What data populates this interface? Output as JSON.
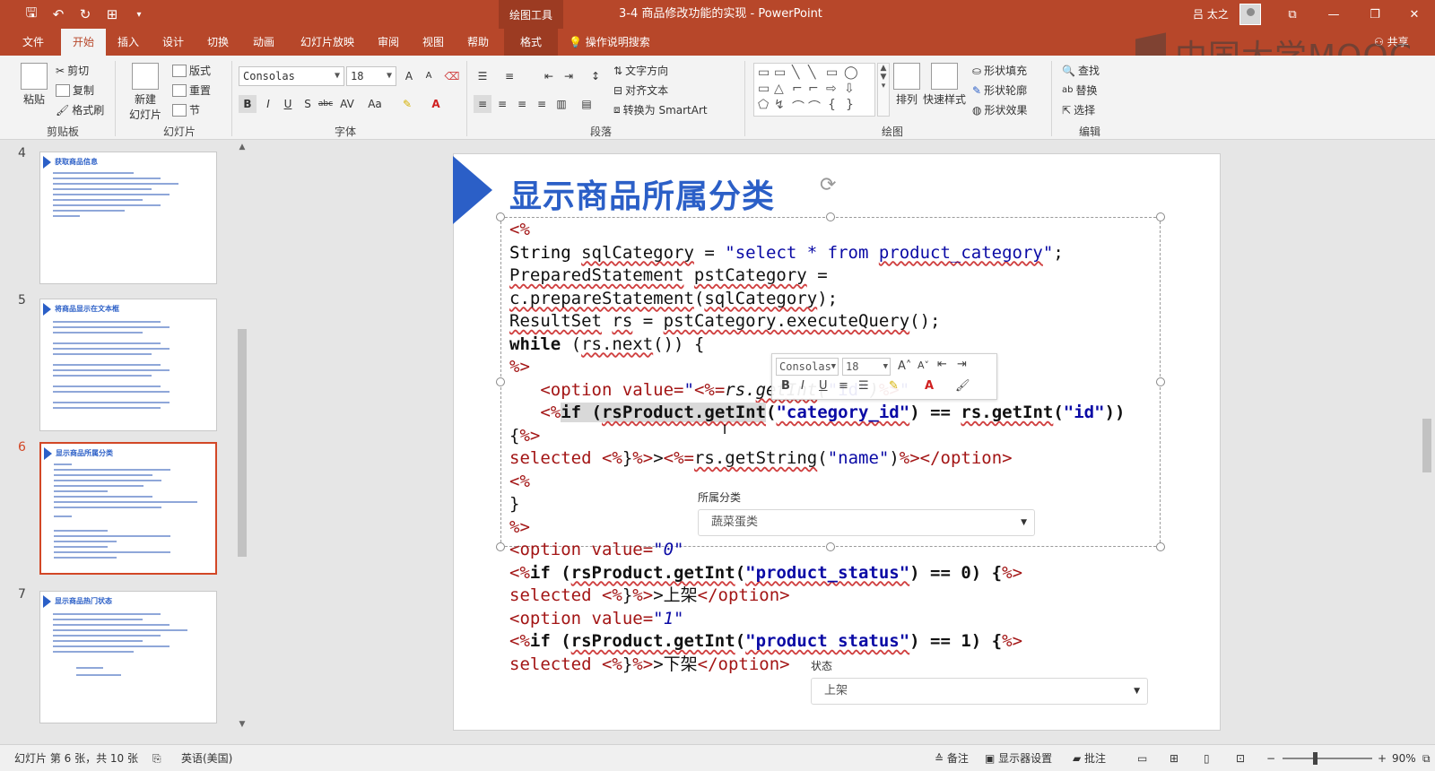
{
  "titlebar": {
    "qat": [
      "save-icon",
      "undo-icon",
      "redo-icon",
      "presentation-icon",
      "customize-icon"
    ],
    "context_tool": "绘图工具",
    "doc_title": "3-4 商品修改功能的实现  -  PowerPoint",
    "user": "吕 太之",
    "ribbon_display": "⧉",
    "minimize": "—",
    "restore": "❐",
    "close": "✕"
  },
  "tabs": [
    "文件",
    "开始",
    "插入",
    "设计",
    "切换",
    "动画",
    "幻灯片放映",
    "审阅",
    "视图",
    "帮助",
    "格式"
  ],
  "tellme": "操作说明搜索",
  "share": "共享",
  "watermark": "中国大学MOOC",
  "ribbon": {
    "clipboard": {
      "paste": "粘贴",
      "cut": "剪切",
      "copy": "复制",
      "format_painter": "格式刷",
      "label": "剪贴板"
    },
    "slides": {
      "new_slide": "新建",
      "new_slide2": "幻灯片",
      "layout": "版式",
      "reset": "重置",
      "section": "节",
      "label": "幻灯片"
    },
    "font": {
      "name": "Consolas",
      "size": "18",
      "label": "字体",
      "bold": "B",
      "italic": "I",
      "underline": "U",
      "shadow": "S",
      "strike": "abc",
      "spacing": "AV",
      "case": "Aa",
      "grow": "A",
      "shrink": "A"
    },
    "paragraph": {
      "text_direction": "文字方向",
      "align_text": "对齐文本",
      "smartart": "转换为 SmartArt",
      "label": "段落"
    },
    "drawing": {
      "arrange": "排列",
      "quick_styles": "快速样式",
      "fill": "形状填充",
      "outline": "形状轮廓",
      "effects": "形状效果",
      "label": "绘图"
    },
    "editing": {
      "find": "查找",
      "replace": "替换",
      "select": "选择",
      "label": "编辑"
    }
  },
  "thumbnails": [
    {
      "num": "4",
      "title": "获取商品信息"
    },
    {
      "num": "5",
      "title": "将商品显示在文本框"
    },
    {
      "num": "6",
      "title": "显示商品所属分类"
    },
    {
      "num": "7",
      "title": "显示商品热门状态"
    }
  ],
  "slide": {
    "title": "显示商品所属分类",
    "minibar_font": "Consolas",
    "minibar_size": "18",
    "form_label_category": "所属分类",
    "form_value_category": "蔬菜蛋类",
    "form_label_status": "状态",
    "form_value_status": "上架"
  },
  "status": {
    "slide_info": "幻灯片 第 6 张，共 10 张",
    "language": "英语(美国)",
    "notes": "备注",
    "display_settings": "显示器设置",
    "comments": "批注",
    "zoom": "90%"
  }
}
